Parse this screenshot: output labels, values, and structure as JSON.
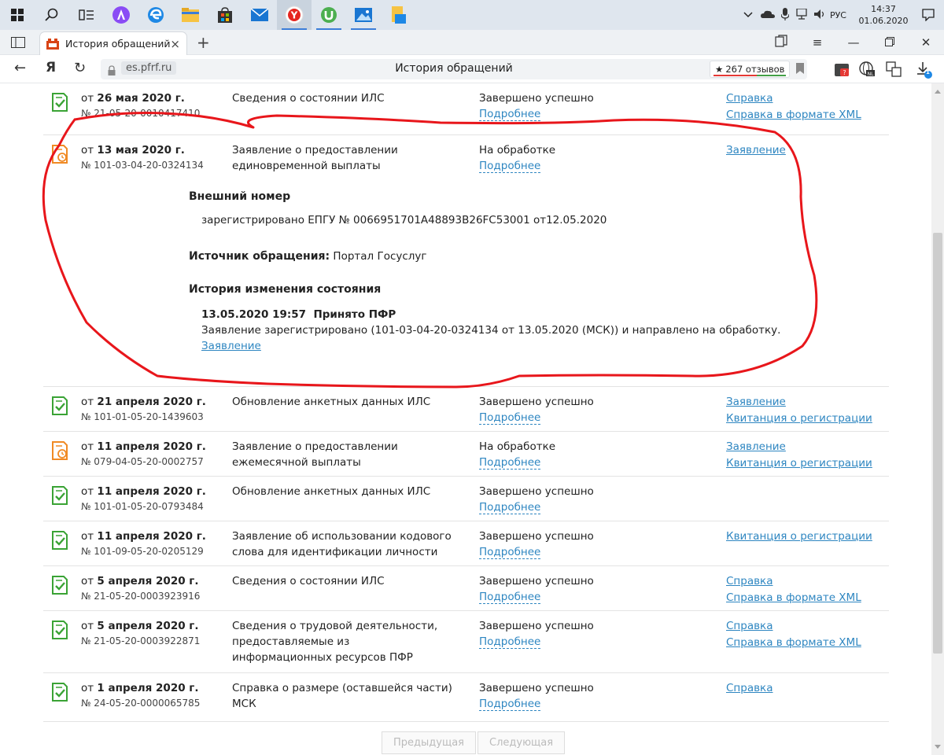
{
  "taskbar": {
    "clock_time": "14:37",
    "clock_date": "01.06.2020",
    "language": "РУС"
  },
  "browser": {
    "tab_title": "История обращений",
    "host": "es.pfrf.ru",
    "page_title": "История обращений",
    "reviews": "267 отзывов",
    "download_badge": "1"
  },
  "rows": [
    {
      "date_prefix": "от",
      "date": "26 мая 2020 г.",
      "number": "№ 21-05-20-0010417410",
      "name": "Сведения о состоянии ИЛС",
      "status": "Завершено успешно",
      "details_link": "Подробнее",
      "links": [
        "Справка",
        "Справка в формате XML"
      ],
      "state": "done"
    },
    {
      "date_prefix": "от",
      "date": "13 мая 2020 г.",
      "number": "№ 101-03-04-20-0324134",
      "name": "Заявление о предоставлении единовременной выплаты",
      "status": "На обработке",
      "details_link": "Подробнее",
      "links": [
        "Заявление"
      ],
      "state": "processing"
    },
    {
      "date_prefix": "от",
      "date": "21 апреля 2020 г.",
      "number": "№ 101-01-05-20-1439603",
      "name": "Обновление анкетных данных ИЛС",
      "status": "Завершено успешно",
      "details_link": "Подробнее",
      "links": [
        "Заявление",
        "Квитанция о регистрации"
      ],
      "state": "done"
    },
    {
      "date_prefix": "от",
      "date": "11 апреля 2020 г.",
      "number": "№ 079-04-05-20-0002757",
      "name": "Заявление о предоставлении ежемесячной выплаты",
      "status": "На обработке",
      "details_link": "Подробнее",
      "links": [
        "Заявление",
        "Квитанция о регистрации"
      ],
      "state": "processing"
    },
    {
      "date_prefix": "от",
      "date": "11 апреля 2020 г.",
      "number": "№ 101-01-05-20-0793484",
      "name": "Обновление анкетных данных ИЛС",
      "status": "Завершено успешно",
      "details_link": "Подробнее",
      "links": [],
      "state": "done"
    },
    {
      "date_prefix": "от",
      "date": "11 апреля 2020 г.",
      "number": "№ 101-09-05-20-0205129",
      "name": "Заявление об использовании кодового слова для идентификации личности",
      "status": "Завершено успешно",
      "details_link": "Подробнее",
      "links": [
        "Квитанция о регистрации"
      ],
      "state": "done"
    },
    {
      "date_prefix": "от",
      "date": "5 апреля 2020 г.",
      "number": "№ 21-05-20-0003923916",
      "name": "Сведения о состоянии ИЛС",
      "status": "Завершено успешно",
      "details_link": "Подробнее",
      "links": [
        "Справка",
        "Справка в формате XML"
      ],
      "state": "done"
    },
    {
      "date_prefix": "от",
      "date": "5 апреля 2020 г.",
      "number": "№ 21-05-20-0003922871",
      "name": "Сведения о трудовой деятельности, предоставляемые из информационных ресурсов ПФР",
      "status": "Завершено успешно",
      "details_link": "Подробнее",
      "links": [
        "Справка",
        "Справка в формате XML"
      ],
      "state": "done"
    },
    {
      "date_prefix": "от",
      "date": "1 апреля 2020 г.",
      "number": "№ 24-05-20-0000065785",
      "name": "Справка о размере (оставшейся части) МСК",
      "status": "Завершено успешно",
      "details_link": "Подробнее",
      "links": [
        "Справка"
      ],
      "state": "done"
    }
  ],
  "expanded": {
    "external_number_heading": "Внешний номер",
    "external_number_text": "зарегистрировано ЕПГУ № 0066951701A48893B26FC53001 от12.05.2020",
    "source_label": "Источник обращения:",
    "source_value": "Портал Госуслуг",
    "history_heading": "История изменения состояния",
    "history_entry_title": "13.05.2020 19:57  Принято ПФР",
    "history_entry_text": "Заявление зарегистрировано (101-03-04-20-0324134 от 13.05.2020 (МСК)) и направлено на обработку.",
    "history_entry_link": "Заявление"
  },
  "pager": {
    "prev": "Предыдущая",
    "next": "Следующая"
  },
  "colors": {
    "done": "#3aa335",
    "processing": "#f08a24",
    "link": "#2e86c1",
    "annotation": "#e8161b"
  }
}
